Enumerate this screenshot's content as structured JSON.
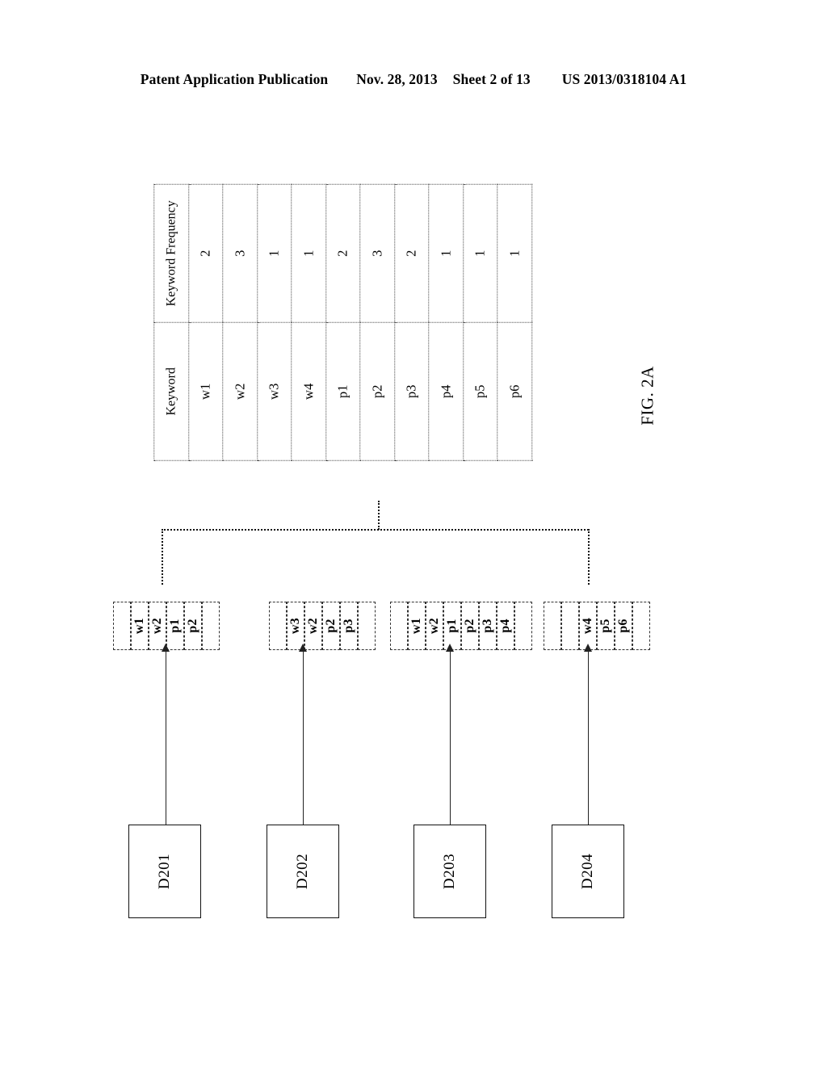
{
  "header": {
    "publication": "Patent Application Publication",
    "date": "Nov. 28, 2013",
    "sheet": "Sheet 2 of 13",
    "patent_number": "US 2013/0318104 A1"
  },
  "figure": {
    "caption": "FIG. 2A"
  },
  "keyword_table": {
    "columns": [
      "Keyword",
      "Keyword Frequency"
    ],
    "rows": [
      {
        "keyword": "w1",
        "frequency": "2"
      },
      {
        "keyword": "w2",
        "frequency": "3"
      },
      {
        "keyword": "w3",
        "frequency": "1"
      },
      {
        "keyword": "w4",
        "frequency": "1"
      },
      {
        "keyword": "p1",
        "frequency": "2"
      },
      {
        "keyword": "p2",
        "frequency": "3"
      },
      {
        "keyword": "p3",
        "frequency": "2"
      },
      {
        "keyword": "p4",
        "frequency": "1"
      },
      {
        "keyword": "p5",
        "frequency": "1"
      },
      {
        "keyword": "p6",
        "frequency": "1"
      }
    ]
  },
  "keyword_groups": [
    {
      "id": "group-1",
      "cells": [
        "",
        "w1",
        "w2",
        "p1",
        "p2",
        ""
      ]
    },
    {
      "id": "group-2",
      "cells": [
        "",
        "w3",
        "w2",
        "p2",
        "p3",
        ""
      ]
    },
    {
      "id": "group-3",
      "cells": [
        "",
        "w1",
        "w2",
        "p1",
        "p2",
        "p3",
        "p4",
        ""
      ]
    },
    {
      "id": "group-4",
      "cells": [
        "",
        "",
        "w4",
        "p5",
        "p6",
        ""
      ]
    }
  ],
  "documents": [
    {
      "label": "D201"
    },
    {
      "label": "D202"
    },
    {
      "label": "D203"
    },
    {
      "label": "D204"
    }
  ]
}
